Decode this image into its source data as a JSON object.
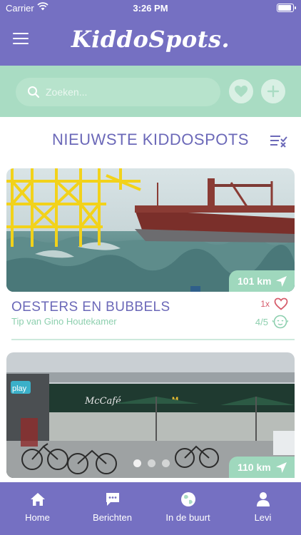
{
  "status_bar": {
    "carrier": "Carrier",
    "time": "3:26 PM"
  },
  "header": {
    "logo_text": "KiddoSpots.",
    "menu_icon": "hamburger-menu-icon"
  },
  "search": {
    "placeholder": "Zoeken...",
    "favorites_icon": "heart-icon",
    "add_icon": "plus-icon"
  },
  "section": {
    "title": "NIEUWSTE KIDDOSPOTS",
    "filter_icon": "filter-list-icon"
  },
  "cards": [
    {
      "title": "OESTERS EN BUBBELS",
      "subtitle": "Tip van Gino Houtekamer",
      "distance": "101 km",
      "likes": "1x",
      "rating": "4/5",
      "image": "offshore-platform-and-cargo-ship-photo"
    },
    {
      "title": "",
      "subtitle": "",
      "distance": "110 km",
      "image": "mccafe-restaurant-with-bicycles-photo",
      "carousel_dots": 3
    }
  ],
  "tabbar": {
    "tabs": [
      {
        "label": "Home",
        "icon": "home-icon"
      },
      {
        "label": "Berichten",
        "icon": "chat-icon"
      },
      {
        "label": "In de buurt",
        "icon": "globe-icon"
      },
      {
        "label": "Levi",
        "icon": "user-icon"
      }
    ]
  },
  "colors": {
    "header": "#7570c2",
    "search_band": "#a9dcc3",
    "title_purple": "#6b68b8",
    "mint_text": "#8ccfae",
    "heart_red": "#d65c6b"
  }
}
